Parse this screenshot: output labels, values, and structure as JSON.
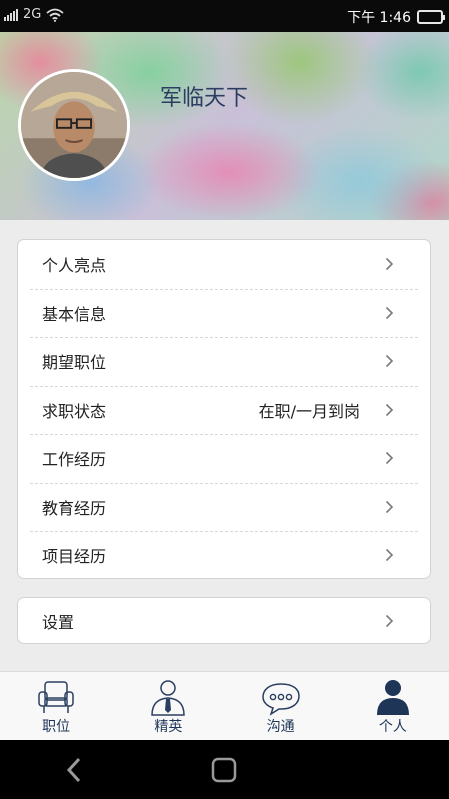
{
  "status_bar": {
    "network": "2G",
    "time": "下午 1:46",
    "battery_color": "#38c44a"
  },
  "profile": {
    "name": "军临天下"
  },
  "menu": {
    "items": [
      {
        "label": "个人亮点",
        "value": ""
      },
      {
        "label": "基本信息",
        "value": ""
      },
      {
        "label": "期望职位",
        "value": ""
      },
      {
        "label": "求职状态",
        "value": "在职/一月到岗"
      },
      {
        "label": "工作经历",
        "value": ""
      },
      {
        "label": "教育经历",
        "value": ""
      },
      {
        "label": "项目经历",
        "value": ""
      }
    ],
    "settings_label": "设置"
  },
  "tabs": [
    {
      "label": "职位",
      "icon": "chair-icon"
    },
    {
      "label": "精英",
      "icon": "person-tie-icon"
    },
    {
      "label": "沟通",
      "icon": "chat-bubble-icon"
    },
    {
      "label": "个人",
      "icon": "person-filled-icon"
    }
  ],
  "colors": {
    "accent": "#1e3558",
    "name_color": "#2d3c62"
  }
}
